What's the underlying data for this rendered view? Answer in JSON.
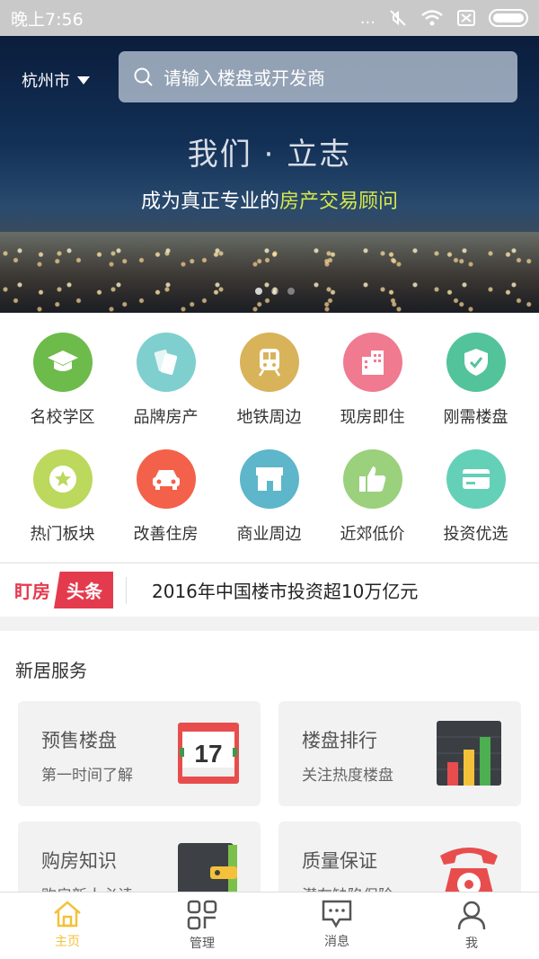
{
  "status_bar": {
    "time": "晚上7:56",
    "dots": "..."
  },
  "header": {
    "city": "杭州市",
    "search_placeholder": "请输入楼盘或开发商"
  },
  "banner": {
    "title": "我们 · 立志",
    "subtitle_prefix": "成为真正专业的",
    "subtitle_highlight": "房产交易顾问",
    "slides": 3,
    "active_slide": 1
  },
  "categories": [
    {
      "label": "名校学区",
      "icon": "graduation-cap-icon",
      "color": "#6dbb4a"
    },
    {
      "label": "品牌房产",
      "icon": "tags-icon",
      "color": "#7fcfcf"
    },
    {
      "label": "地铁周边",
      "icon": "train-icon",
      "color": "#d8b35a"
    },
    {
      "label": "现房即住",
      "icon": "building-icon",
      "color": "#f07a90"
    },
    {
      "label": "刚需楼盘",
      "icon": "shield-check-icon",
      "color": "#52c39a"
    },
    {
      "label": "热门板块",
      "icon": "star-icon",
      "color": "#bcd85d"
    },
    {
      "label": "改善住房",
      "icon": "car-icon",
      "color": "#f4614a"
    },
    {
      "label": "商业周边",
      "icon": "shop-icon",
      "color": "#5db6c9"
    },
    {
      "label": "近郊低价",
      "icon": "thumbs-up-icon",
      "color": "#9bd07c"
    },
    {
      "label": "投资优选",
      "icon": "card-icon",
      "color": "#64d0b8"
    }
  ],
  "headline": {
    "tag_a": "盯房",
    "tag_b": "头条",
    "text": "2016年中国楼市投资超10万亿元"
  },
  "service": {
    "title": "新居服务",
    "cards": [
      {
        "title": "预售楼盘",
        "subtitle": "第一时间了解",
        "icon": "calendar-icon",
        "badge": "17"
      },
      {
        "title": "楼盘排行",
        "subtitle": "关注热度楼盘",
        "icon": "bar-chart-icon"
      },
      {
        "title": "购房知识",
        "subtitle": "购房新人必读",
        "icon": "wallet-icon"
      },
      {
        "title": "质量保证",
        "subtitle": "潜在缺陷保险",
        "icon": "telephone-icon"
      }
    ]
  },
  "nav": [
    {
      "label": "主页",
      "icon": "home-icon",
      "active": true
    },
    {
      "label": "管理",
      "icon": "grid-icon"
    },
    {
      "label": "消息",
      "icon": "message-icon"
    },
    {
      "label": "我",
      "icon": "user-icon"
    }
  ],
  "colors": {
    "accent": "#f3c23a",
    "headline_red": "#e43a4e"
  }
}
